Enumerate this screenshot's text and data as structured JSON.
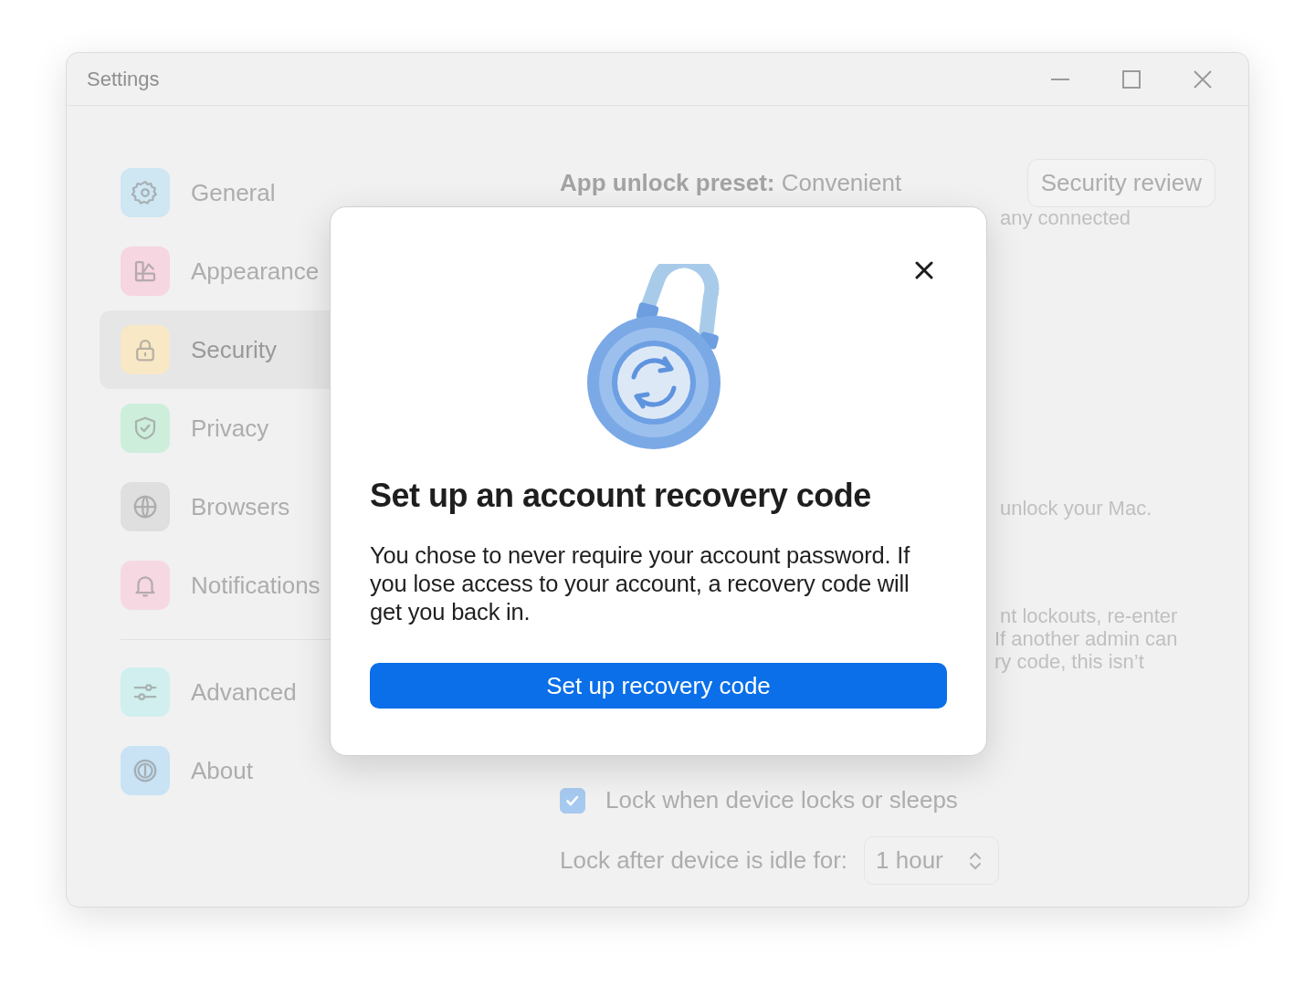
{
  "window": {
    "title": "Settings"
  },
  "sidebar": {
    "groups": [
      [
        {
          "label": "General",
          "color": "#cfe6f3",
          "selected": false
        },
        {
          "label": "Appearance",
          "color": "#f6d6e0",
          "selected": false
        },
        {
          "label": "Security",
          "color": "#f8e8c6",
          "selected": true
        },
        {
          "label": "Privacy",
          "color": "#cdeedb",
          "selected": false
        },
        {
          "label": "Browsers",
          "color": "#dfdfdf",
          "selected": false
        },
        {
          "label": "Notifications",
          "color": "#f6d8e3",
          "selected": false
        }
      ],
      [
        {
          "label": "Advanced",
          "color": "#d0efee",
          "selected": false
        },
        {
          "label": "About",
          "color": "#c9e2f4",
          "selected": false
        }
      ]
    ]
  },
  "content": {
    "preset": "**App unlock preset:** Convenient",
    "review_button": "Security review",
    "fragments": [
      "any connected",
      "unlock your Mac."
    ],
    "paragraph": [
      "nt lockouts, re-enter",
      "If another admin can",
      "ry code, this isn’t"
    ],
    "lock_checkbox": {
      "label": "Lock when device locks or sleeps",
      "checked": true
    },
    "idle": {
      "label": "Lock after device is idle for:",
      "value": "1 hour"
    }
  },
  "dialog": {
    "title": "Set up an account recovery code",
    "body": "You chose to never require your account password. If you lose access to your account, a recovery code will get you back in.",
    "button": "Set up recovery code"
  }
}
